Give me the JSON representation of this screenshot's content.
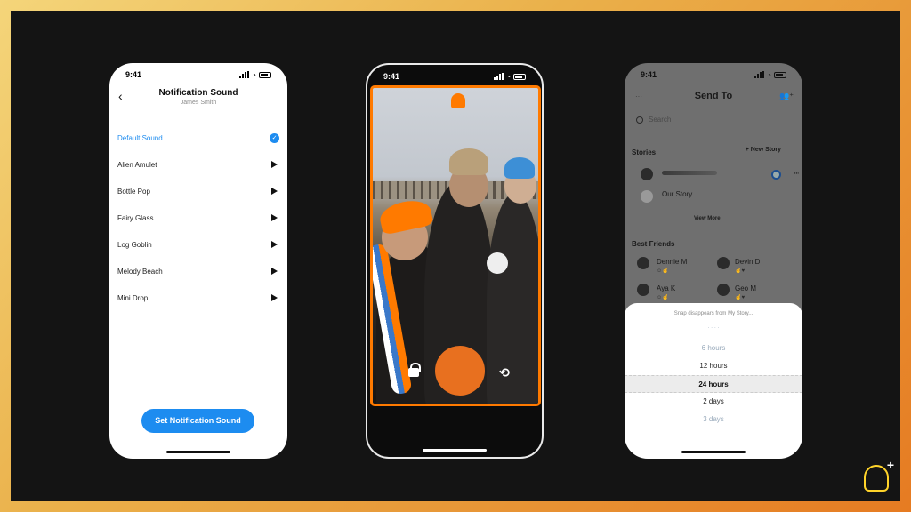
{
  "status_time": "9:41",
  "phone1": {
    "title": "Notification Sound",
    "subtitle": "James Smith",
    "sounds": [
      "Default Sound",
      "Alien Amulet",
      "Bottle Pop",
      "Fairy Glass",
      "Log Goblin",
      "Melody Beach",
      "Mini Drop"
    ],
    "selected_index": 0,
    "button_label": "Set Notification Sound"
  },
  "phone3": {
    "title": "Send To",
    "search_placeholder": "Search",
    "stories_label": "Stories",
    "new_story": "+ New Story",
    "our_story": "Our Story",
    "view_more": "View More",
    "best_friends_label": "Best Friends",
    "friends": [
      "Dennie M",
      "Devin D",
      "Aya K",
      "Geo M"
    ],
    "sheet_caption": "Snap disappears from My Story...",
    "durations": [
      "6 hours",
      "12 hours",
      "24 hours",
      "2 days",
      "3 days"
    ],
    "selected_duration": "24 hours"
  },
  "colors": {
    "accent_blue": "#1d8cf0",
    "snap_orange": "#ff7a00",
    "logo_yellow": "#ffd42a"
  }
}
